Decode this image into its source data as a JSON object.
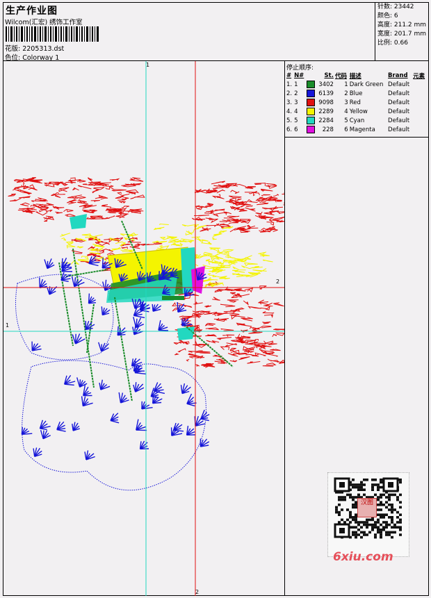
{
  "header": {
    "title": "生产作业图",
    "subtitle": "Wilcom(汇宏) 绣饰工作室",
    "design_line": "花版: 2205313.dst",
    "colorway_line": "色位: Colorway 1"
  },
  "stats": {
    "stitches": "针数: 23442",
    "colors": "颜色: 6",
    "height": "高度: 211.2 mm",
    "width": "宽度: 201.7 mm",
    "scale": "比例: 0.66"
  },
  "legend": {
    "caption": "停止顺序:",
    "headers": [
      "#",
      "N#",
      "St.",
      "代码",
      "描述",
      "Brand",
      "元素"
    ],
    "rows": [
      {
        "idx": "1.",
        "n": "1",
        "color": "#1a8c2a",
        "st": "3402",
        "code": "1",
        "desc": "Dark Green",
        "brand": "Default"
      },
      {
        "idx": "2.",
        "n": "2",
        "color": "#1515d8",
        "st": "6139",
        "code": "2",
        "desc": "Blue",
        "brand": "Default"
      },
      {
        "idx": "3.",
        "n": "3",
        "color": "#e01010",
        "st": "9098",
        "code": "3",
        "desc": "Red",
        "brand": "Default"
      },
      {
        "idx": "4.",
        "n": "4",
        "color": "#f4f400",
        "st": "2289",
        "code": "4",
        "desc": "Yellow",
        "brand": "Default"
      },
      {
        "idx": "5.",
        "n": "5",
        "color": "#22d8c0",
        "st": "2284",
        "code": "5",
        "desc": "Cyan",
        "brand": "Default"
      },
      {
        "idx": "6.",
        "n": "6",
        "color": "#e010e0",
        "st": "228",
        "code": "6",
        "desc": "Magenta",
        "brand": "Default"
      }
    ]
  },
  "axes": {
    "v1_top": "1",
    "v2_bottom": "2",
    "h1_left": "1",
    "h2_right": "2"
  },
  "watermark": "6xiu.com",
  "qr_stamp": "汉图"
}
